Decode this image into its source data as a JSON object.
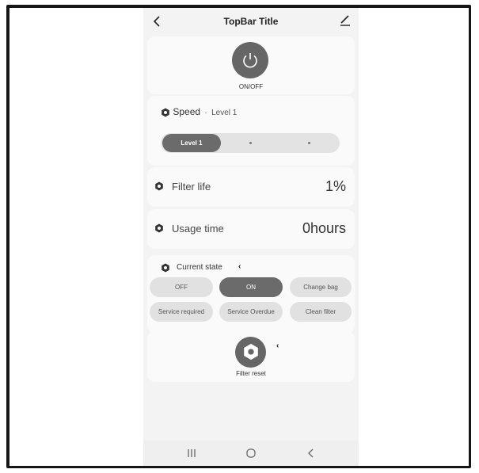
{
  "topbar": {
    "title": "TopBar Title"
  },
  "power": {
    "label": "ON/OFF"
  },
  "speed": {
    "title": "Speed",
    "separator": "·",
    "current": "Level 1",
    "active_label": "Level 1"
  },
  "filter_life": {
    "label": "Filter life",
    "value": "1%"
  },
  "usage_time": {
    "label": "Usage time",
    "value": "0hours"
  },
  "current_state": {
    "label": "Current state",
    "options": [
      "OFF",
      "ON",
      "Change bag",
      "Service required",
      "Service Overdue",
      "Clean filter"
    ],
    "selected": "ON"
  },
  "filter_reset": {
    "label": "Filter reset"
  },
  "colors": {
    "accent": "#666666",
    "pill": "#e1e1e1",
    "background": "#f3f3f3",
    "card": "#fafafa"
  },
  "icons": {
    "back": "chevron-left-icon",
    "edit": "edit-icon",
    "power": "power-icon",
    "bullet": "hex-nut-icon"
  }
}
